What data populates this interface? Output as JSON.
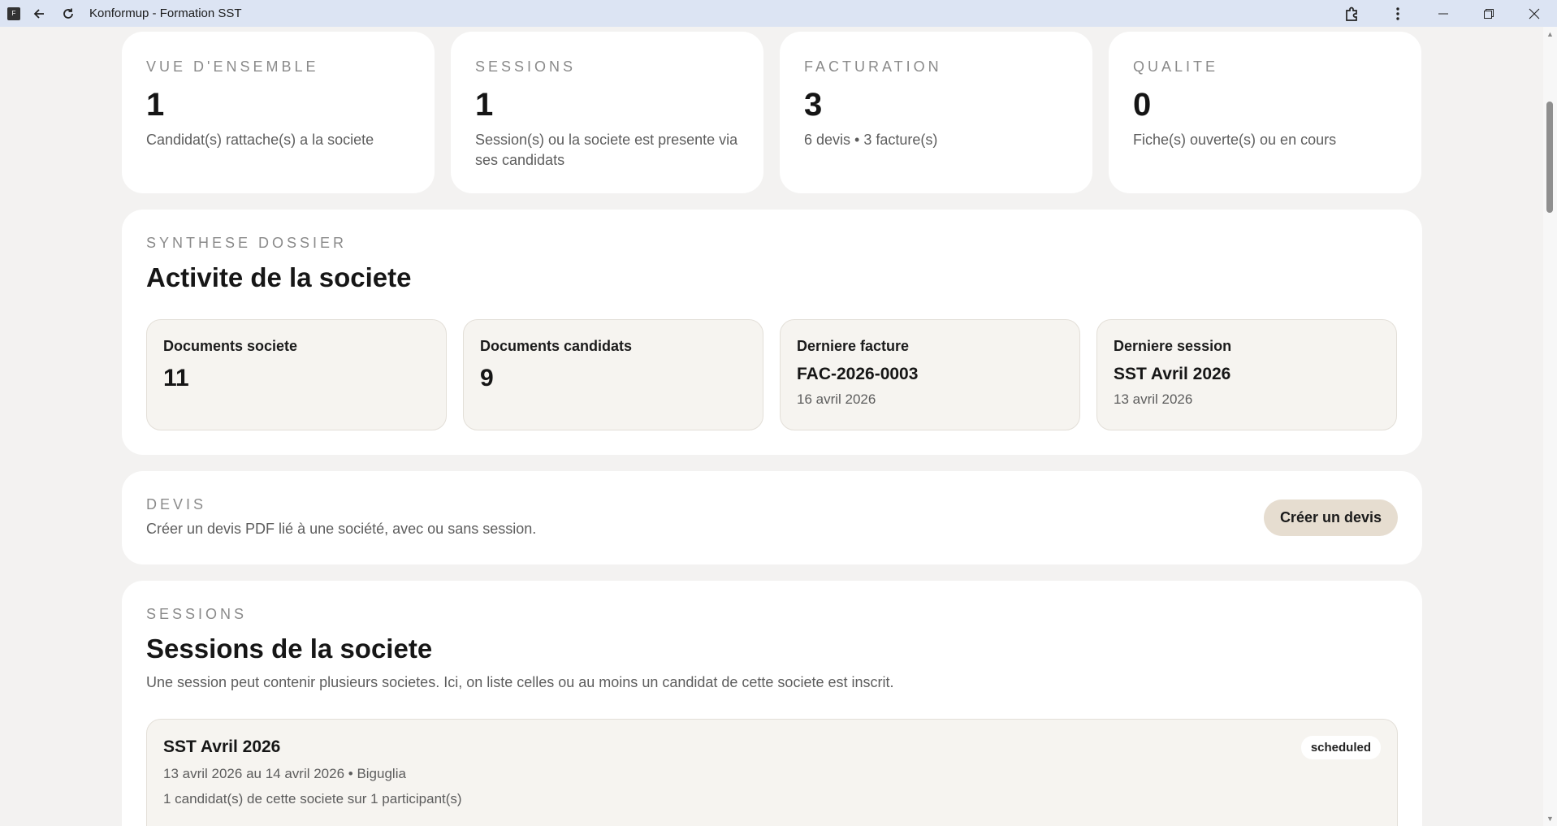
{
  "window": {
    "title": "Konformup - Formation SST",
    "app_icon_letter": "F"
  },
  "stats": [
    {
      "eyebrow": "VUE D'ENSEMBLE",
      "value": "1",
      "desc": "Candidat(s) rattache(s) a la societe"
    },
    {
      "eyebrow": "SESSIONS",
      "value": "1",
      "desc": "Session(s) ou la societe est presente via ses candidats"
    },
    {
      "eyebrow": "FACTURATION",
      "value": "3",
      "desc": "6 devis • 3 facture(s)"
    },
    {
      "eyebrow": "QUALITE",
      "value": "0",
      "desc": "Fiche(s) ouverte(s) ou en cours"
    }
  ],
  "synthese": {
    "eyebrow": "SYNTHESE DOSSIER",
    "title": "Activite de la societe",
    "tiles": [
      {
        "label": "Documents societe",
        "value": "11"
      },
      {
        "label": "Documents candidats",
        "value": "9"
      },
      {
        "label": "Derniere facture",
        "value": "FAC-2026-0003",
        "date": "16 avril 2026"
      },
      {
        "label": "Derniere session",
        "value": "SST Avril 2026",
        "date": "13 avril 2026"
      }
    ]
  },
  "devis": {
    "eyebrow": "DEVIS",
    "desc": "Créer un devis PDF lié à une société, avec ou sans session.",
    "button": "Créer un devis"
  },
  "sessions": {
    "eyebrow": "SESSIONS",
    "title": "Sessions de la societe",
    "desc": "Une session peut contenir plusieurs societes. Ici, on liste celles ou au moins un candidat de cette societe est inscrit.",
    "items": [
      {
        "name": "SST Avril 2026",
        "status": "scheduled",
        "dates_location": "13 avril 2026 au 14 avril 2026 • Biguglia",
        "participants": "1 candidat(s) de cette societe sur 1 participant(s)"
      }
    ]
  }
}
